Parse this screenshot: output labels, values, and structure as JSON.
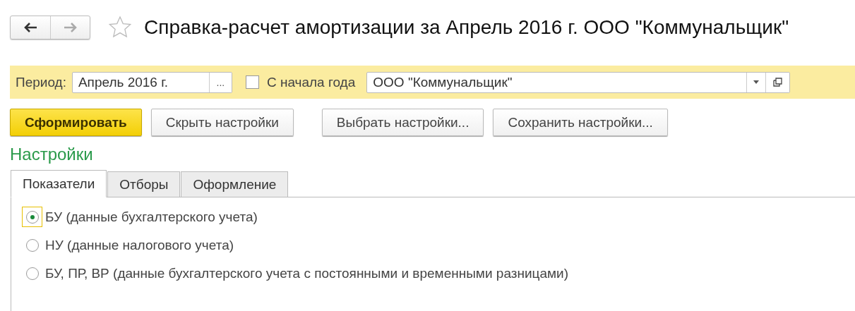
{
  "title": "Справка-расчет амортизации за Апрель 2016 г. ООО \"Коммунальщик\"",
  "favorite": false,
  "params": {
    "period_label": "Период:",
    "period_value": "Апрель 2016 г.",
    "period_button": "...",
    "from_year_start": {
      "label": "С начала года",
      "checked": false
    },
    "organization": "ООО \"Коммунальщик\""
  },
  "buttons": [
    {
      "label": "Сформировать",
      "kind": "primary"
    },
    {
      "label": "Скрыть настройки",
      "kind": "normal"
    },
    {
      "label": "Выбрать настройки...",
      "kind": "normal"
    },
    {
      "label": "Сохранить настройки...",
      "kind": "normal"
    }
  ],
  "settings_title": "Настройки",
  "tabs": [
    {
      "label": "Показатели",
      "selected": true
    },
    {
      "label": "Отборы",
      "selected": false
    },
    {
      "label": "Оформление",
      "selected": false
    }
  ],
  "options": [
    {
      "label": "БУ (данные бухгалтерского учета)",
      "selected": true
    },
    {
      "label": "НУ (данные налогового учета)",
      "selected": false
    },
    {
      "label": "БУ, ПР, ВР (данные бухгалтерского учета с постоянными и временными разницами)",
      "selected": false
    }
  ]
}
